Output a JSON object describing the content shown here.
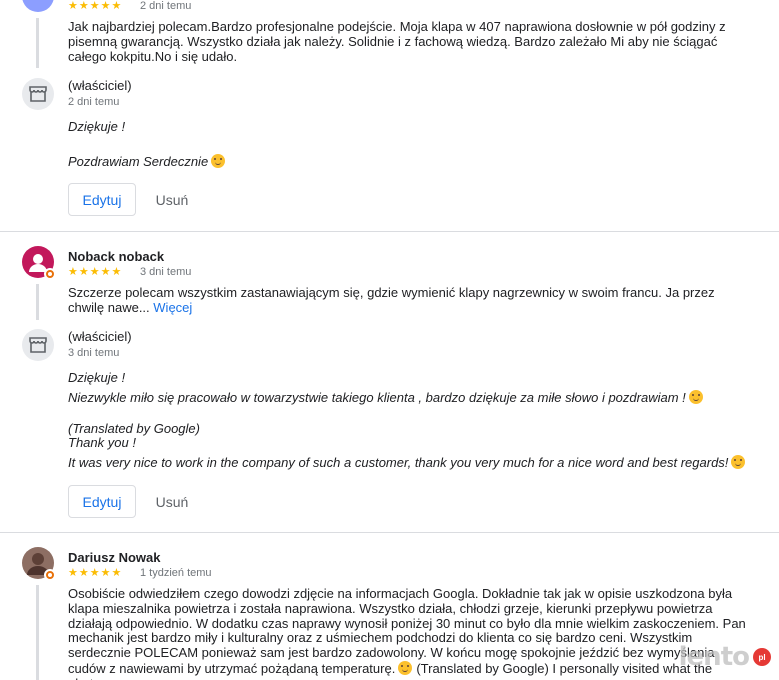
{
  "reviews": [
    {
      "name": "",
      "stars": "★★★★★",
      "date": "2 dni temu",
      "text": "Jak najbardziej polecam.Bardzo profesjonalne podejście. Moja klapa w 407 naprawiona dosłownie w pół godziny z pisemną gwarancją. Wszystko działa jak należy. Solidnie i z fachową wiedzą. Bardzo zależało Mi aby nie ściągać całego kokpitu.No i się udało.",
      "more": "",
      "owner": {
        "label": "(właściciel)",
        "date": "2 dni temu",
        "line1": "Dziękuje !",
        "line2": "Pozdrawiam Serdecznie"
      },
      "actions": {
        "edit": "Edytuj",
        "delete": "Usuń"
      }
    },
    {
      "name": "Noback noback",
      "stars": "★★★★★",
      "date": "3 dni temu",
      "text": "Szczerze polecam wszystkim zastanawiającym się, gdzie wymienić klapy nagrzewnicy w swoim francu. Ja przez chwilę nawe...",
      "more": "Więcej",
      "owner": {
        "label": "(właściciel)",
        "date": "3 dni temu",
        "line1": "Dziękuje !",
        "line2": "Niezwykle miło się pracowało w towarzystwie takiego klienta , bardzo dziękuje za miłe słowo i pozdrawiam !",
        "line3": "(Translated by Google)",
        "line4": "Thank you !",
        "line5": "It was very nice to work in the company of such a customer, thank you very much for a nice word and best regards!"
      },
      "actions": {
        "edit": "Edytuj",
        "delete": "Usuń"
      }
    },
    {
      "name": "Dariusz Nowak",
      "stars": "★★★★★",
      "date": "1 tydzień temu",
      "text": "Osobiście odwiedziłem czego dowodzi zdjęcie na informacjach Googla. Dokładnie tak jak w opisie uszkodzona była klapa mieszalnika powietrza i została naprawiona. Wszystko działa, chłodzi grzeje, kierunki przepływu powietrza działają odpowiednio. W dodatku czas naprawy wynosił poniżej 30 minut co było dla mnie wielkim zaskoczeniem. Pan mechanik jest bardzo miły i kulturalny oraz z uśmiechem podchodzi do klienta co się bardzo ceni. Wszystkim serdecznie POLECAM ponieważ sam jest bardzo zadowolony. W końcu mogę spokojnie jeździć bez wymyślania cudów z nawiewami by utrzymać pożądaną temperaturę.",
      "text_tail": "(Translated by Google) I personally visited what the photo proves on"
    }
  ],
  "watermark": {
    "text": "lento",
    "badge": "pl"
  },
  "colors": {
    "star": "#fbbc04",
    "link": "#1a73e8",
    "avatar1": "#8c9eff",
    "avatar2": "#c2185b",
    "avatar3": "#8d6e63",
    "badge": "#e8710a"
  }
}
